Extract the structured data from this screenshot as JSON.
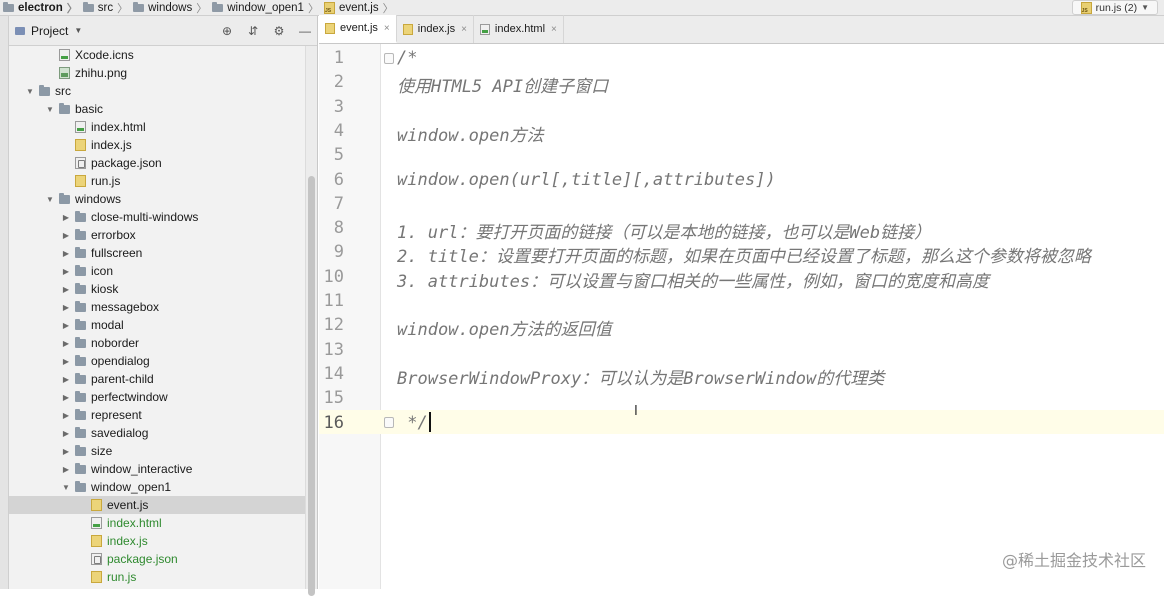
{
  "breadcrumb": [
    {
      "label": "electron",
      "icon": "folder-icon",
      "bold": true
    },
    {
      "label": "src",
      "icon": "folder-icon"
    },
    {
      "label": "windows",
      "icon": "folder-icon"
    },
    {
      "label": "window_open1",
      "icon": "folder-icon"
    },
    {
      "label": "event.js",
      "icon": "js-file-icon"
    }
  ],
  "run_config": {
    "label": "run.js (2)"
  },
  "project_panel": {
    "title": "Project",
    "tree": [
      {
        "label": "Xcode.icns",
        "type": "file-generic",
        "depth": 2
      },
      {
        "label": "zhihu.png",
        "type": "image",
        "depth": 2
      },
      {
        "label": "src",
        "type": "folder-open",
        "depth": 1
      },
      {
        "label": "basic",
        "type": "folder-open",
        "depth": 2
      },
      {
        "label": "index.html",
        "type": "html",
        "depth": 3
      },
      {
        "label": "index.js",
        "type": "js",
        "depth": 3
      },
      {
        "label": "package.json",
        "type": "json",
        "depth": 3
      },
      {
        "label": "run.js",
        "type": "js",
        "depth": 3
      },
      {
        "label": "windows",
        "type": "folder-open",
        "depth": 2
      },
      {
        "label": "close-multi-windows",
        "type": "folder",
        "depth": 3
      },
      {
        "label": "errorbox",
        "type": "folder",
        "depth": 3
      },
      {
        "label": "fullscreen",
        "type": "folder",
        "depth": 3
      },
      {
        "label": "icon",
        "type": "folder",
        "depth": 3
      },
      {
        "label": "kiosk",
        "type": "folder",
        "depth": 3
      },
      {
        "label": "messagebox",
        "type": "folder",
        "depth": 3
      },
      {
        "label": "modal",
        "type": "folder",
        "depth": 3
      },
      {
        "label": "noborder",
        "type": "folder",
        "depth": 3
      },
      {
        "label": "opendialog",
        "type": "folder",
        "depth": 3
      },
      {
        "label": "parent-child",
        "type": "folder",
        "depth": 3
      },
      {
        "label": "perfectwindow",
        "type": "folder",
        "depth": 3
      },
      {
        "label": "represent",
        "type": "folder",
        "depth": 3
      },
      {
        "label": "savedialog",
        "type": "folder",
        "depth": 3
      },
      {
        "label": "size",
        "type": "folder",
        "depth": 3
      },
      {
        "label": "window_interactive",
        "type": "folder",
        "depth": 3
      },
      {
        "label": "window_open1",
        "type": "folder-open",
        "depth": 3
      },
      {
        "label": "event.js",
        "type": "js",
        "depth": 4,
        "selected": true
      },
      {
        "label": "index.html",
        "type": "html",
        "depth": 4,
        "green": true
      },
      {
        "label": "index.js",
        "type": "js",
        "depth": 4,
        "green": true
      },
      {
        "label": "package.json",
        "type": "json",
        "depth": 4,
        "green": true
      },
      {
        "label": "run.js",
        "type": "js",
        "depth": 4,
        "green": true
      }
    ]
  },
  "tabs": [
    {
      "label": "event.js",
      "icon": "js-file-icon",
      "active": true
    },
    {
      "label": "index.js",
      "icon": "js-file-icon"
    },
    {
      "label": "index.html",
      "icon": "html-file-icon"
    }
  ],
  "editor": {
    "lines": [
      {
        "num": "1",
        "text": "/*"
      },
      {
        "num": "2",
        "text": "使用HTML5 API创建子窗口"
      },
      {
        "num": "3",
        "text": ""
      },
      {
        "num": "4",
        "text": "window.open方法"
      },
      {
        "num": "5",
        "text": ""
      },
      {
        "num": "6",
        "text": "window.open(url[,title][,attributes])"
      },
      {
        "num": "7",
        "text": ""
      },
      {
        "num": "8",
        "text": "1. url：要打开页面的链接（可以是本地的链接，也可以是Web链接）"
      },
      {
        "num": "9",
        "text": "2. title：设置要打开页面的标题，如果在页面中已经设置了标题，那么这个参数将被忽略"
      },
      {
        "num": "10",
        "text": "3. attributes：可以设置与窗口相关的一些属性，例如，窗口的宽度和高度"
      },
      {
        "num": "11",
        "text": ""
      },
      {
        "num": "12",
        "text": "window.open方法的返回值"
      },
      {
        "num": "13",
        "text": ""
      },
      {
        "num": "14",
        "text": "BrowserWindowProxy：可以认为是BrowserWindow的代理类"
      },
      {
        "num": "15",
        "text": ""
      },
      {
        "num": "16",
        "text": " */"
      }
    ],
    "current_line": "16"
  },
  "watermark": "@稀土掘金技术社区",
  "colors": {
    "selection": "#d4d4d4",
    "vcs_added": "#2f8a2f",
    "comment": "#767676",
    "current_line_bg": "#fffde8"
  }
}
